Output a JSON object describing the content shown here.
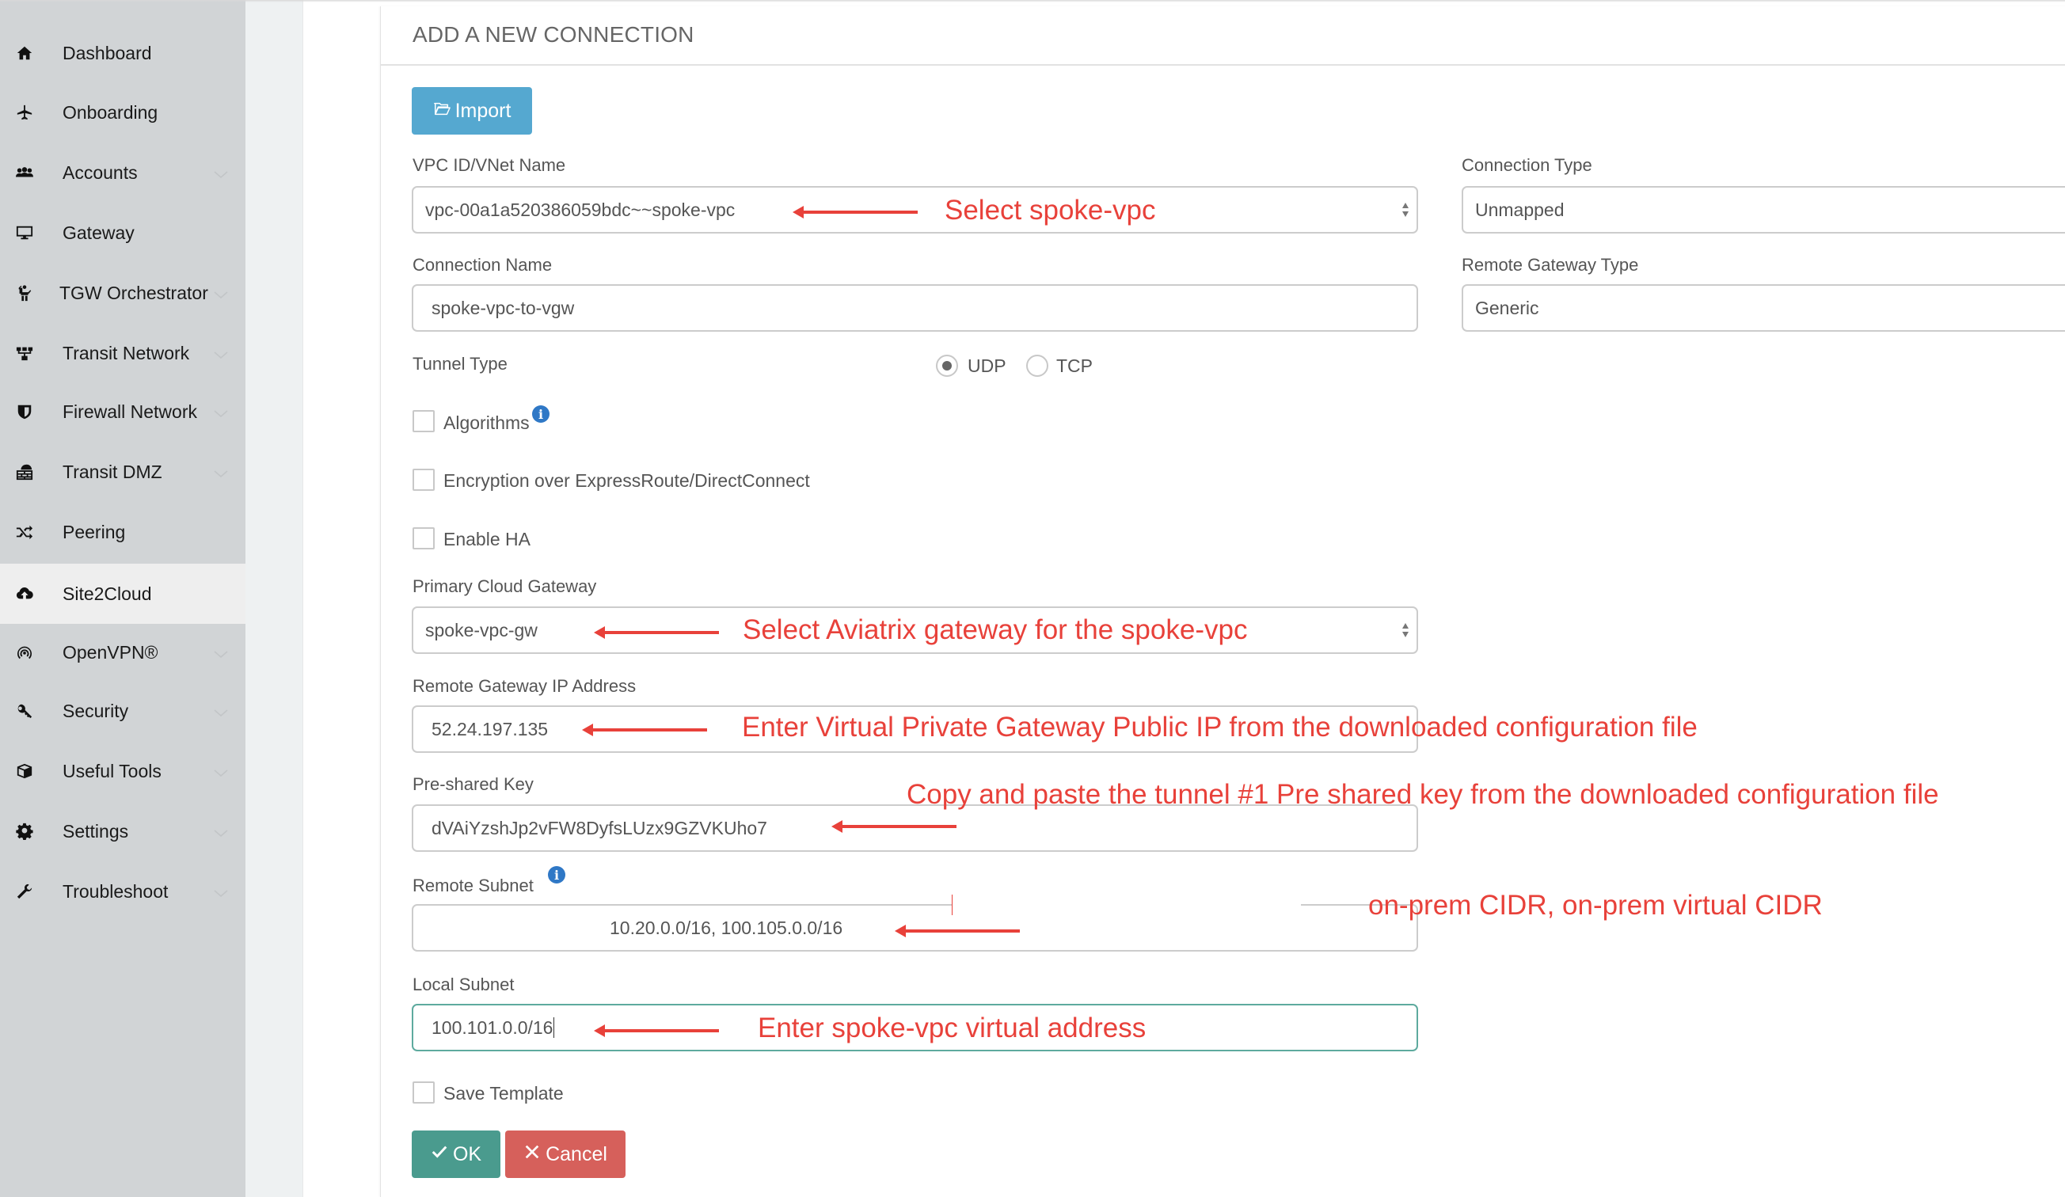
{
  "sidebar": {
    "items": [
      {
        "label": "Dashboard",
        "icon": "home-icon",
        "expandable": false,
        "active": false
      },
      {
        "label": "Onboarding",
        "icon": "airplane-icon",
        "expandable": false,
        "active": false
      },
      {
        "label": "Accounts",
        "icon": "users-icon",
        "expandable": true,
        "active": false
      },
      {
        "label": "Gateway",
        "icon": "monitor-icon",
        "expandable": false,
        "active": false
      },
      {
        "label": "TGW Orchestrator",
        "icon": "orchestrator-icon",
        "expandable": true,
        "active": false
      },
      {
        "label": "Transit Network",
        "icon": "network-icon",
        "expandable": true,
        "active": false
      },
      {
        "label": "Firewall Network",
        "icon": "shield-icon",
        "expandable": true,
        "active": false
      },
      {
        "label": "Transit DMZ",
        "icon": "firewall-icon",
        "expandable": true,
        "active": false
      },
      {
        "label": "Peering",
        "icon": "shuffle-icon",
        "expandable": false,
        "active": false
      },
      {
        "label": "Site2Cloud",
        "icon": "cloud-upload-icon",
        "expandable": false,
        "active": true
      },
      {
        "label": "OpenVPN®",
        "icon": "wireless-icon",
        "expandable": true,
        "active": false
      },
      {
        "label": "Security",
        "icon": "key-icon",
        "expandable": true,
        "active": false
      },
      {
        "label": "Useful Tools",
        "icon": "cube-icon",
        "expandable": true,
        "active": false
      },
      {
        "label": "Settings",
        "icon": "gear-icon",
        "expandable": true,
        "active": false
      },
      {
        "label": "Troubleshoot",
        "icon": "wrench-icon",
        "expandable": true,
        "active": false
      }
    ]
  },
  "form": {
    "title": "ADD A NEW CONNECTION",
    "import_label": "Import",
    "vpc": {
      "label": "VPC ID/VNet Name",
      "value": "vpc-00a1a520386059bdc~~spoke-vpc"
    },
    "connection_type": {
      "label": "Connection Type",
      "value": "Unmapped"
    },
    "connection_name": {
      "label": "Connection Name",
      "value": "spoke-vpc-to-vgw"
    },
    "remote_gateway_type": {
      "label": "Remote Gateway Type",
      "value": "Generic"
    },
    "tunnel_type": {
      "label": "Tunnel Type",
      "options": [
        "UDP",
        "TCP"
      ],
      "selected": "UDP"
    },
    "algorithms": {
      "label": "Algorithms",
      "checked": false
    },
    "encryption": {
      "label": "Encryption over ExpressRoute/DirectConnect",
      "checked": false
    },
    "enable_ha": {
      "label": "Enable HA",
      "checked": false
    },
    "primary_gateway": {
      "label": "Primary Cloud Gateway",
      "value": "spoke-vpc-gw"
    },
    "remote_ip": {
      "label": "Remote Gateway IP Address",
      "value": "52.24.197.135"
    },
    "psk": {
      "label": "Pre-shared Key",
      "value": "dVAiYzshJp2vFW8DyfsLUzx9GZVKUho7"
    },
    "remote_subnet": {
      "label": "Remote Subnet",
      "value": "10.20.0.0/16, 100.105.0.0/16"
    },
    "local_subnet": {
      "label": "Local Subnet",
      "value": "100.101.0.0/16"
    },
    "save_template": {
      "label": "Save Template",
      "checked": false
    },
    "ok_label": "OK",
    "cancel_label": "Cancel"
  },
  "annotations": {
    "vpc": "Select spoke-vpc",
    "primary_gateway": "Select Aviatrix gateway for the spoke-vpc",
    "remote_ip": "Enter Virtual Private Gateway Public IP from the downloaded configuration file",
    "psk": "Copy and paste the tunnel #1 Pre shared key from the downloaded configuration file",
    "remote_subnet": "on-prem CIDR, on-prem virtual CIDR",
    "local_subnet": "Enter spoke-vpc virtual address"
  },
  "colors": {
    "annotation": "#e8413a",
    "import": "#55a8d0",
    "ok": "#4a9b8e",
    "cancel": "#d6605b",
    "sidebar": "#d1d4d6",
    "active_item": "#eeeeee",
    "focus_border": "#5eaa9e"
  }
}
